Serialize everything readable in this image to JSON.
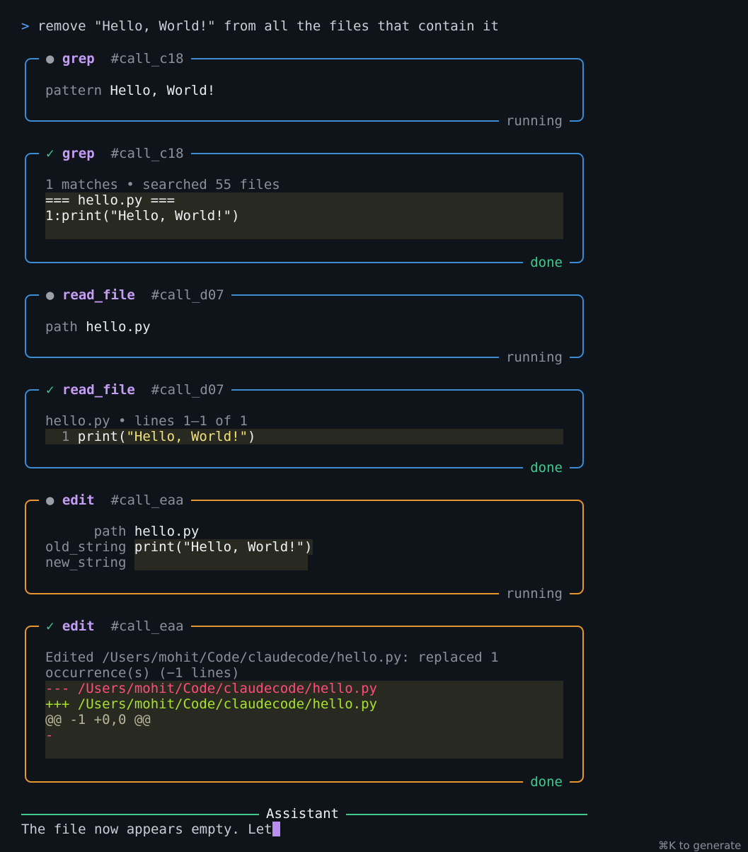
{
  "prompt": {
    "char": ">",
    "text": "remove \"Hello, World!\" from all the files that contain it"
  },
  "cards": [
    {
      "status_icon": "●",
      "tool": "grep",
      "call_id": "#call_c18",
      "status": "running",
      "pattern_key": "pattern",
      "pattern_val": "Hello, World!"
    },
    {
      "status_icon": "✓",
      "tool": "grep",
      "call_id": "#call_c18",
      "status": "done",
      "summary": "1 matches • searched 55 files",
      "code": [
        "=== hello.py ===",
        "1:print(\"Hello, World!\")"
      ]
    },
    {
      "status_icon": "●",
      "tool": "read_file",
      "call_id": "#call_d07",
      "status": "running",
      "path_key": "path",
      "path_val": "hello.py"
    },
    {
      "status_icon": "✓",
      "tool": "read_file",
      "call_id": "#call_d07",
      "status": "done",
      "summary": "hello.py • lines 1–1 of 1",
      "line_no": "1",
      "code_prefix": "print(",
      "code_string": "\"Hello, World!\"",
      "code_suffix": ")"
    },
    {
      "status_icon": "●",
      "tool": "edit",
      "call_id": "#call_eaa",
      "status": "running",
      "path_key": "path",
      "path_val": "hello.py",
      "old_key": "old_string",
      "old_val": "print(\"Hello, World!\")",
      "new_key": "new_string",
      "new_val": ""
    },
    {
      "status_icon": "✓",
      "tool": "edit",
      "call_id": "#call_eaa",
      "status": "done",
      "summary_1": "Edited /Users/mohit/Code/claudecode/hello.py: replaced 1",
      "summary_2": "occurrence(s) (−1 lines)",
      "diff_minus": "--- /Users/mohit/Code/claudecode/hello.py",
      "diff_plus": "+++ /Users/mohit/Code/claudecode/hello.py",
      "diff_hunk": "@@ -1 +0,0 @@",
      "diff_removed": "-"
    }
  ],
  "assistant": {
    "label": "Assistant",
    "text": "The file now appears empty. Let"
  },
  "hint": "⌘K to generate",
  "colors": {
    "blue_border": "#3d8bd0",
    "orange_border": "#e8962f",
    "done": "#3fc98a",
    "tool": "#c59df5"
  }
}
